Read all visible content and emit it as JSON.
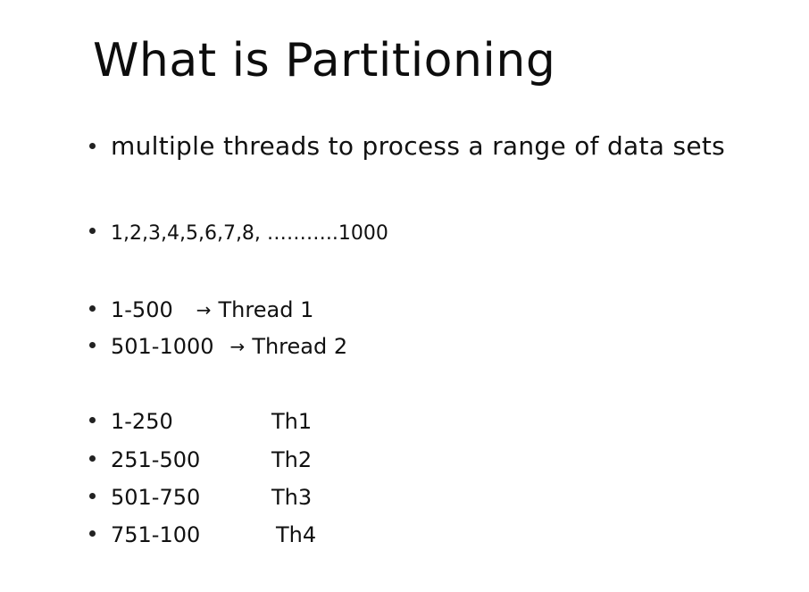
{
  "slide": {
    "title": "What is Partitioning",
    "bullets": {
      "intro": "multiple threads to process a range of data sets",
      "sequence": "1,2,3,4,5,6,7,8, ………..1000",
      "two_threads": [
        {
          "range": "1-500",
          "arrow": "→",
          "thread": "Thread 1"
        },
        {
          "range": "501-1000",
          "arrow": "→",
          "thread": "Thread 2"
        }
      ],
      "four_threads": [
        {
          "range": "1-250",
          "thread": "Th1"
        },
        {
          "range": "251-500",
          "thread": "Th2"
        },
        {
          "range": "501-750",
          "thread": "Th3"
        },
        {
          "range": "751-100",
          "thread": "Th4"
        }
      ]
    }
  }
}
